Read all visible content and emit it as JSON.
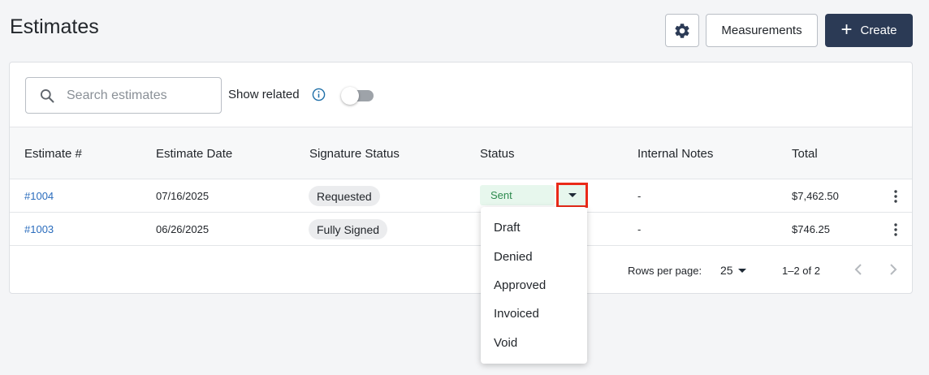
{
  "page": {
    "title": "Estimates"
  },
  "toolbar": {
    "settings_icon": "gear-icon",
    "measurements_label": "Measurements",
    "create_label": "Create",
    "create_icon": "plus-icon"
  },
  "filters": {
    "search_placeholder": "Search estimates",
    "search_value": "",
    "show_related_label": "Show related",
    "show_related_on": false
  },
  "table": {
    "columns": [
      "Estimate #",
      "Estimate Date",
      "Signature Status",
      "Status",
      "Internal Notes",
      "Total"
    ],
    "rows": [
      {
        "number": "#1004",
        "date": "07/16/2025",
        "signature": "Requested",
        "status": "Sent",
        "notes": "-",
        "total": "$7,462.50"
      },
      {
        "number": "#1003",
        "date": "06/26/2025",
        "signature": "Fully Signed",
        "status": "",
        "notes": "-",
        "total": "$746.25"
      }
    ]
  },
  "pagination": {
    "rows_per_page_label": "Rows per page:",
    "rows_per_page": "25",
    "range": "1–2 of 2"
  },
  "status_dropdown": {
    "options": [
      "Draft",
      "Denied",
      "Approved",
      "Invoiced",
      "Void"
    ]
  },
  "colors": {
    "primary": "#2b3a55",
    "link": "#2a6cbd",
    "status_sent_bg": "#e7f7ed",
    "status_sent_text": "#2d8a4e",
    "highlight": "#ea2a18"
  }
}
